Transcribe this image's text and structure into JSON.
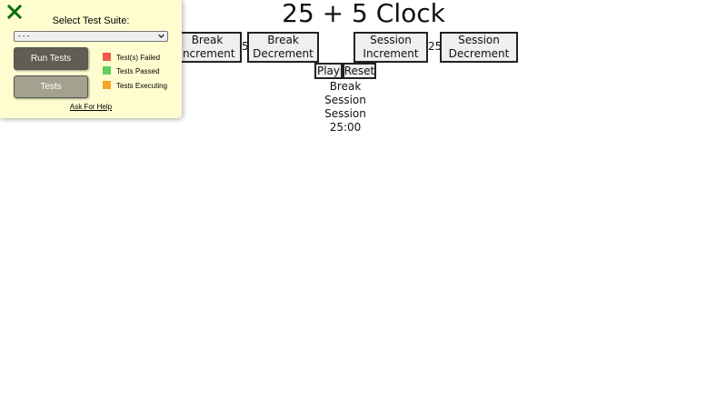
{
  "app": {
    "title": "25 + 5 Clock",
    "controls": {
      "break_increment": "Break Increment",
      "break_decrement": "Break Decrement",
      "break_length": "5",
      "session_increment": "Session Increment",
      "session_decrement": "Session Decrement",
      "session_length": "25",
      "play": "Play",
      "reset": "Reset"
    },
    "status": {
      "line1": "Break",
      "line2": "Session",
      "timer_label": "Session",
      "time_left": "25:00"
    }
  },
  "test_panel": {
    "title": "Select Test Suite:",
    "suite_select": {
      "selected": "- - -"
    },
    "run_tests_label": "Run Tests",
    "tests_label": "Tests",
    "legend": [
      {
        "label": "Test(s) Failed",
        "color": "#ef5a4a"
      },
      {
        "label": "Tests Passed",
        "color": "#5fce5f"
      },
      {
        "label": "Tests Executing",
        "color": "#f5a32a"
      }
    ],
    "help_link": "Ask For Help",
    "close_icon_color": "#0b6e0b"
  }
}
